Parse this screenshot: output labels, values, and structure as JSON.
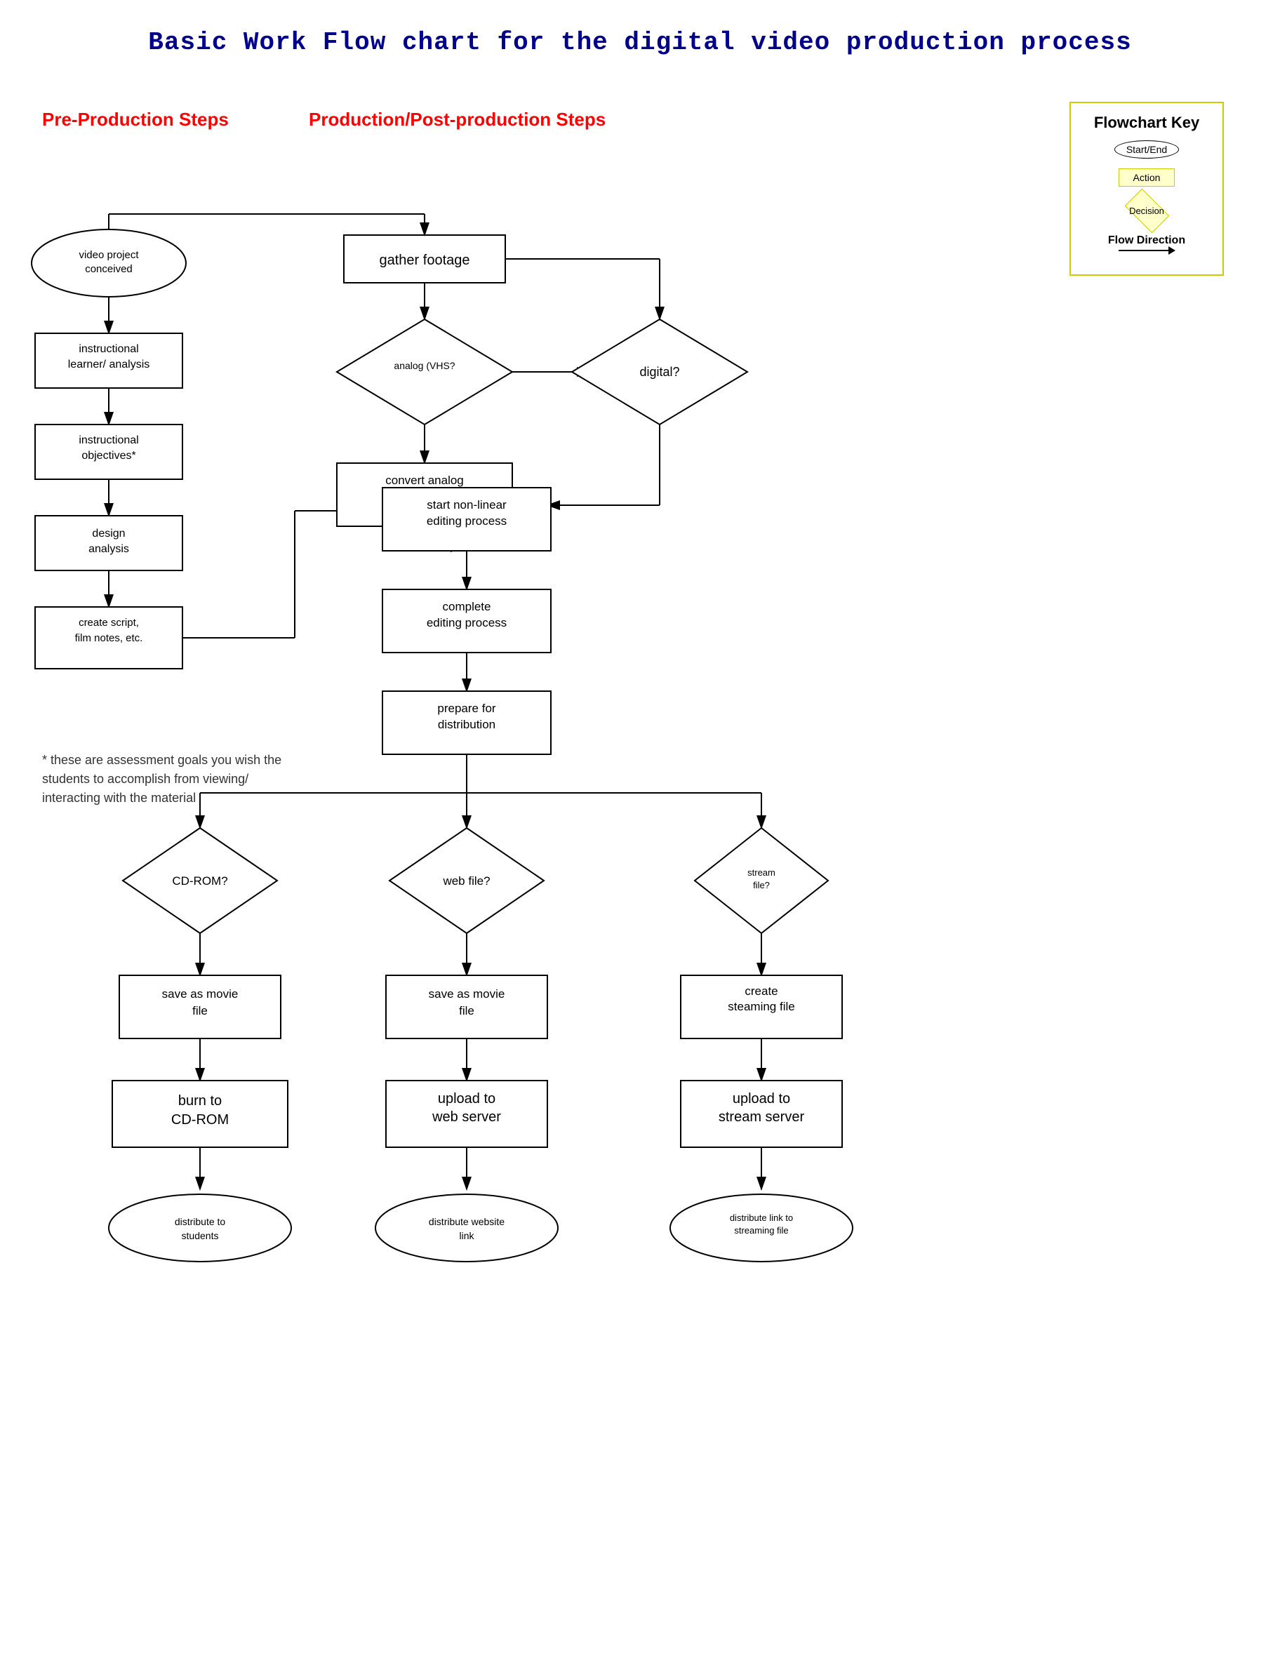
{
  "title": "Basic Work Flow chart for the digital video production process",
  "sections": {
    "pre_production": "Pre-Production Steps",
    "production": "Production/Post-production Steps"
  },
  "key": {
    "title": "Flowchart Key",
    "start_end": "Start/End",
    "action": "Action",
    "decision": "Decision",
    "flow_direction": "Flow Direction"
  },
  "nodes": {
    "video_project": "video project conceived",
    "instructional_learner": "instructional learner/ analysis",
    "instructional_objectives": "instructional objectives*",
    "design_analysis": "design analysis",
    "create_script": "create script, film notes, etc.",
    "gather_footage": "gather footage",
    "analog_vhs": "analog (VHS?",
    "digital": "digital?",
    "convert_analog": "convert analog to digital",
    "start_nonlinear": "start non-linear editing process",
    "complete_editing": "complete editing process",
    "prepare_distribution": "prepare for distribution",
    "cdrom_q": "CD-ROM?",
    "web_file_q": "web file?",
    "stream_file_q": "stream file?",
    "save_movie_cdrom": "save as movie file",
    "save_movie_web": "save as movie file",
    "create_streaming": "create steaming file",
    "burn_cdrom": "burn to CD-ROM",
    "upload_web": "upload to web server",
    "upload_stream": "upload to stream server",
    "distribute_students": "distribute to students",
    "distribute_website": "distribute website link",
    "distribute_link": "distribute link to streaming file"
  },
  "footnote": "* these are assessment goals you wish the students to accomplish from viewing/ interacting with the material"
}
